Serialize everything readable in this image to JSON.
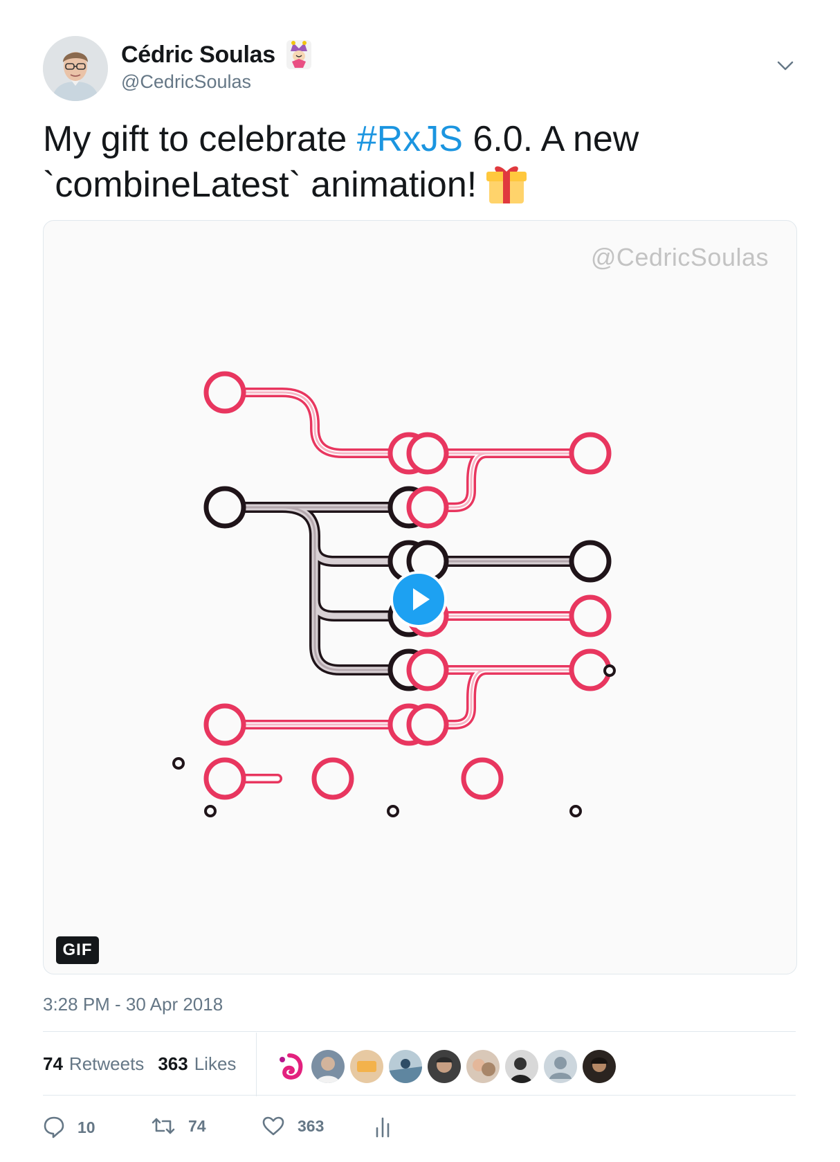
{
  "author": {
    "display_name": "Cédric Soulas",
    "handle": "@CedricSoulas"
  },
  "tweet": {
    "text_before": "My gift to celebrate ",
    "hashtag": "#RxJS",
    "text_after": " 6.0. A new `combineLatest` animation!",
    "timestamp": "3:28 PM - 30 Apr 2018"
  },
  "media": {
    "watermark": "@CedricSoulas",
    "badge": "GIF"
  },
  "stats": {
    "retweets_count": "74",
    "retweets_label": "Retweets",
    "likes_count": "363",
    "likes_label": "Likes"
  },
  "actions": {
    "reply_count": "10",
    "retweet_count": "74",
    "like_count": "363"
  },
  "icons": {
    "menu": "chevron-down-icon",
    "play": "play-icon",
    "reply": "reply-icon",
    "retweet": "retweet-icon",
    "like": "heart-icon",
    "analytics": "analytics-icon"
  },
  "colors": {
    "accent": "#1b95e0",
    "marble_red": "#e8365f",
    "marble_dark": "#1f1419",
    "muted": "#657786"
  }
}
